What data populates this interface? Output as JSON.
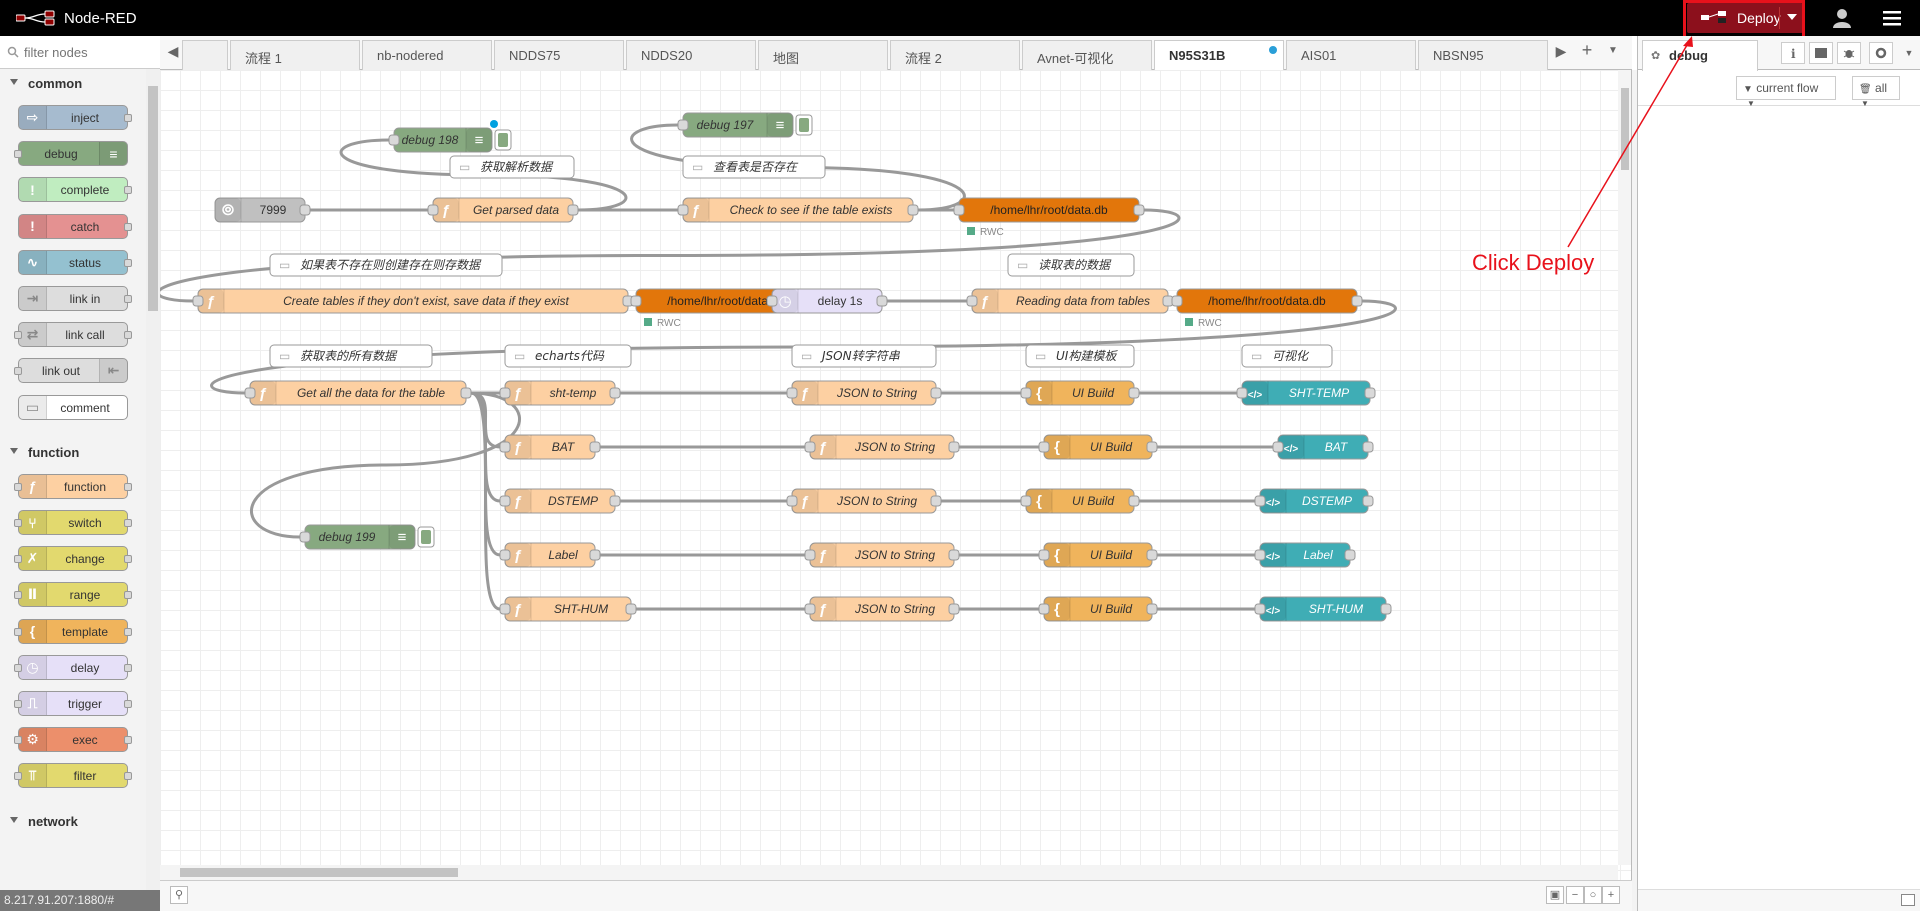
{
  "header": {
    "app_title": "Node-RED",
    "deploy_label": "Deploy",
    "icons": [
      "node-red-logo",
      "deploy-icon",
      "caret-down-icon",
      "user-icon",
      "menu-icon"
    ]
  },
  "palette": {
    "filter_placeholder": "filter nodes",
    "categories": [
      {
        "label": "common",
        "nodes": [
          {
            "label": "inject",
            "color": "#a6bbcf",
            "icon": "arrow-right-icon",
            "side": "left"
          },
          {
            "label": "debug",
            "color": "#87a980",
            "icon": "list-icon",
            "side": "right"
          },
          {
            "label": "complete",
            "color": "#c0edc0",
            "icon": "exclamation-icon",
            "side": "left"
          },
          {
            "label": "catch",
            "color": "#e49191",
            "icon": "exclamation-icon",
            "side": "left"
          },
          {
            "label": "status",
            "color": "#94c1d0",
            "icon": "pulse-icon",
            "side": "left"
          },
          {
            "label": "link in",
            "color": "#dddddd",
            "icon": "link-in-icon",
            "side": "left"
          },
          {
            "label": "link call",
            "color": "#dddddd",
            "icon": "link-call-icon",
            "side": "left"
          },
          {
            "label": "link out",
            "color": "#dddddd",
            "icon": "link-out-icon",
            "side": "right"
          },
          {
            "label": "comment",
            "color": "#ffffff",
            "icon": "comment-icon",
            "side": "left"
          }
        ]
      },
      {
        "label": "function",
        "nodes": [
          {
            "label": "function",
            "color": "#fdd0a2",
            "icon": "function-icon",
            "side": "left"
          },
          {
            "label": "switch",
            "color": "#e2d96e",
            "icon": "switch-icon",
            "side": "left"
          },
          {
            "label": "change",
            "color": "#e2d96e",
            "icon": "change-icon",
            "side": "left"
          },
          {
            "label": "range",
            "color": "#e2d96e",
            "icon": "range-icon",
            "side": "left"
          },
          {
            "label": "template",
            "color": "#f0b45c",
            "icon": "template-icon",
            "side": "left"
          },
          {
            "label": "delay",
            "color": "#e6e0f8",
            "icon": "timer-icon",
            "side": "left"
          },
          {
            "label": "trigger",
            "color": "#e6e0f8",
            "icon": "trigger-icon",
            "side": "left"
          },
          {
            "label": "exec",
            "color": "#ec8f6b",
            "icon": "gear-icon",
            "side": "left"
          },
          {
            "label": "filter",
            "color": "#e2d96e",
            "icon": "filter-icon",
            "side": "left"
          }
        ]
      },
      {
        "label": "network",
        "nodes": []
      }
    ]
  },
  "tabs": [
    {
      "label": "",
      "active": false
    },
    {
      "label": "流程 1",
      "active": false
    },
    {
      "label": "nb-nodered",
      "active": false
    },
    {
      "label": "NDDS75",
      "active": false
    },
    {
      "label": "NDDS20",
      "active": false
    },
    {
      "label": "地图",
      "active": false
    },
    {
      "label": "流程 2",
      "active": false
    },
    {
      "label": "Avnet-可视化",
      "active": false
    },
    {
      "label": "N95S31B",
      "active": true,
      "changed": true
    },
    {
      "label": "AIS01",
      "active": false
    },
    {
      "label": "NBSN95",
      "active": false
    }
  ],
  "flow": {
    "nodes": [
      {
        "id": "n_debug198",
        "label": "debug 198",
        "type": "debug",
        "color": "#87a980",
        "italic": true,
        "changed": true
      },
      {
        "id": "n_debug197",
        "label": "debug 197",
        "type": "debug",
        "color": "#87a980",
        "italic": true
      },
      {
        "id": "c1",
        "label": "获取解析数据",
        "type": "comment"
      },
      {
        "id": "c2",
        "label": "查看表是否存在",
        "type": "comment"
      },
      {
        "id": "n_7999",
        "label": "7999",
        "type": "udp",
        "color": "#c0c0c0"
      },
      {
        "id": "n_parsed",
        "label": "Get parsed data",
        "type": "function",
        "color": "#fdd0a2"
      },
      {
        "id": "n_check",
        "label": "Check to see if the table exists",
        "type": "function",
        "color": "#fdd0a2"
      },
      {
        "id": "n_db1",
        "label": "/home/lhr/root/data.db",
        "type": "sqlite",
        "color": "#e2760b",
        "status": "RWC"
      },
      {
        "id": "c3",
        "label": "如果表不存在则创建存在则存数据",
        "type": "comment"
      },
      {
        "id": "c4",
        "label": "读取表的数据",
        "type": "comment"
      },
      {
        "id": "n_create",
        "label": "Create tables if they don't exist, save data if they exist",
        "type": "function",
        "color": "#fdd0a2"
      },
      {
        "id": "n_db2",
        "label": "/home/lhr/root/data.db",
        "type": "sqlite",
        "color": "#e2760b",
        "status": "RWC"
      },
      {
        "id": "n_delay",
        "label": "delay 1s",
        "type": "delay",
        "color": "#e6e0f8"
      },
      {
        "id": "n_read",
        "label": "Reading data from tables",
        "type": "function",
        "color": "#fdd0a2"
      },
      {
        "id": "n_db3",
        "label": "/home/lhr/root/data.db",
        "type": "sqlite",
        "color": "#e2760b",
        "status": "RWC"
      },
      {
        "id": "c5",
        "label": "获取表的所有数据",
        "type": "comment"
      },
      {
        "id": "c6",
        "label": "echarts代码",
        "type": "comment"
      },
      {
        "id": "c7",
        "label": "JSON转字符串",
        "type": "comment"
      },
      {
        "id": "c8",
        "label": "UI构建模板",
        "type": "comment"
      },
      {
        "id": "c9",
        "label": "可视化",
        "type": "comment"
      },
      {
        "id": "n_getall",
        "label": "Get all the data for the table",
        "type": "function",
        "color": "#fdd0a2"
      },
      {
        "id": "n_shttemp",
        "label": "sht-temp",
        "type": "function",
        "color": "#fdd0a2"
      },
      {
        "id": "n_j1",
        "label": "JSON to String",
        "type": "function",
        "color": "#fdd0a2"
      },
      {
        "id": "n_u1",
        "label": "UI Build",
        "type": "template",
        "color": "#f0b45c"
      },
      {
        "id": "n_o1",
        "label": "SHT-TEMP",
        "type": "ui_template",
        "color": "#3fadb5"
      },
      {
        "id": "n_bat",
        "label": "BAT",
        "type": "function",
        "color": "#fdd0a2"
      },
      {
        "id": "n_j2",
        "label": "JSON to String",
        "type": "function",
        "color": "#fdd0a2"
      },
      {
        "id": "n_u2",
        "label": "UI Build",
        "type": "template",
        "color": "#f0b45c"
      },
      {
        "id": "n_o2",
        "label": "BAT",
        "type": "ui_template",
        "color": "#3fadb5"
      },
      {
        "id": "n_dstemp",
        "label": "DSTEMP",
        "type": "function",
        "color": "#fdd0a2"
      },
      {
        "id": "n_j3",
        "label": "JSON to String",
        "type": "function",
        "color": "#fdd0a2"
      },
      {
        "id": "n_u3",
        "label": "UI Build",
        "type": "template",
        "color": "#f0b45c"
      },
      {
        "id": "n_o3",
        "label": "DSTEMP",
        "type": "ui_template",
        "color": "#3fadb5"
      },
      {
        "id": "n_debug199",
        "label": "debug 199",
        "type": "debug",
        "color": "#87a980",
        "italic": true
      },
      {
        "id": "n_label",
        "label": "Label",
        "type": "function",
        "color": "#fdd0a2"
      },
      {
        "id": "n_j4",
        "label": "JSON to String",
        "type": "function",
        "color": "#fdd0a2"
      },
      {
        "id": "n_u4",
        "label": "UI Build",
        "type": "template",
        "color": "#f0b45c"
      },
      {
        "id": "n_o4",
        "label": "Label",
        "type": "ui_template",
        "color": "#3fadb5"
      },
      {
        "id": "n_shthum",
        "label": "SHT-HUM",
        "type": "function",
        "color": "#fdd0a2"
      },
      {
        "id": "n_j5",
        "label": "JSON to String",
        "type": "function",
        "color": "#fdd0a2"
      },
      {
        "id": "n_u5",
        "label": "UI Build",
        "type": "template",
        "color": "#f0b45c"
      },
      {
        "id": "n_o5",
        "label": "SHT-HUM",
        "type": "ui_template",
        "color": "#3fadb5"
      }
    ]
  },
  "sidebar": {
    "active_tab": "debug",
    "filter_label": "current flow",
    "clear_label": "all",
    "icons": [
      "bug-icon",
      "info-icon",
      "book-icon",
      "bug-icon",
      "gear-icon",
      "chevron-down-icon"
    ]
  },
  "footer": {
    "url": "8.217.91.207:1880/#"
  },
  "annotation": {
    "text": "Click Deploy",
    "color": "#e8111b"
  }
}
